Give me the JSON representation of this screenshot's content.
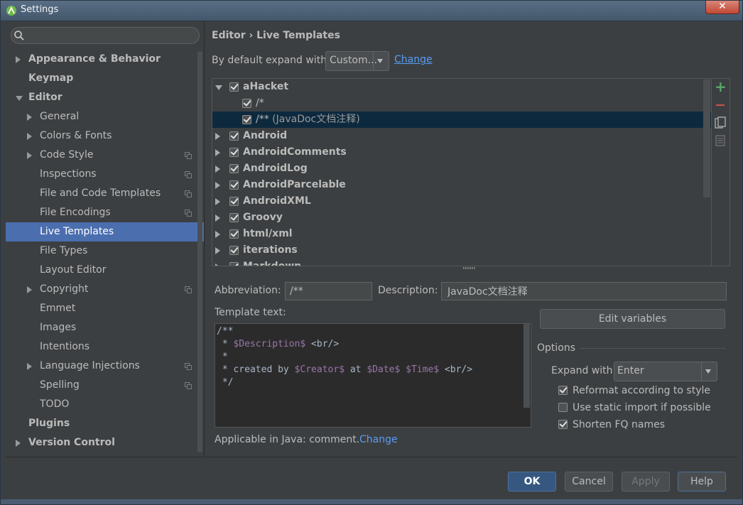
{
  "window": {
    "title": "Settings",
    "close_label": "✕"
  },
  "search": {
    "placeholder": "",
    "value": ""
  },
  "sidebar": {
    "items": [
      {
        "label": "Appearance & Behavior",
        "level": 0,
        "bold": true,
        "arrow": "right"
      },
      {
        "label": "Keymap",
        "level": 0,
        "bold": true,
        "arrow": "none"
      },
      {
        "label": "Editor",
        "level": 0,
        "bold": true,
        "arrow": "down"
      },
      {
        "label": "General",
        "level": 1,
        "bold": false,
        "arrow": "right"
      },
      {
        "label": "Colors & Fonts",
        "level": 1,
        "bold": false,
        "arrow": "right"
      },
      {
        "label": "Code Style",
        "level": 1,
        "bold": false,
        "arrow": "right",
        "project": true
      },
      {
        "label": "Inspections",
        "level": 1,
        "bold": false,
        "arrow": "none",
        "project": true
      },
      {
        "label": "File and Code Templates",
        "level": 1,
        "bold": false,
        "arrow": "none",
        "project": true
      },
      {
        "label": "File Encodings",
        "level": 1,
        "bold": false,
        "arrow": "none",
        "project": true
      },
      {
        "label": "Live Templates",
        "level": 1,
        "bold": false,
        "arrow": "none",
        "selected": true
      },
      {
        "label": "File Types",
        "level": 1,
        "bold": false,
        "arrow": "none"
      },
      {
        "label": "Layout Editor",
        "level": 1,
        "bold": false,
        "arrow": "none"
      },
      {
        "label": "Copyright",
        "level": 1,
        "bold": false,
        "arrow": "right",
        "project": true
      },
      {
        "label": "Emmet",
        "level": 1,
        "bold": false,
        "arrow": "none"
      },
      {
        "label": "Images",
        "level": 1,
        "bold": false,
        "arrow": "none"
      },
      {
        "label": "Intentions",
        "level": 1,
        "bold": false,
        "arrow": "none"
      },
      {
        "label": "Language Injections",
        "level": 1,
        "bold": false,
        "arrow": "right",
        "project": true
      },
      {
        "label": "Spelling",
        "level": 1,
        "bold": false,
        "arrow": "none",
        "project": true
      },
      {
        "label": "TODO",
        "level": 1,
        "bold": false,
        "arrow": "none"
      },
      {
        "label": "Plugins",
        "level": 0,
        "bold": true,
        "arrow": "none"
      },
      {
        "label": "Version Control",
        "level": 0,
        "bold": true,
        "arrow": "right"
      }
    ]
  },
  "header": {
    "breadcrumb_parent": "Editor",
    "breadcrumb_sep": "›",
    "breadcrumb_current": "Live Templates",
    "expand_label": "By default expand with",
    "expand_value": "Custom...",
    "change_link": "Change"
  },
  "tree": {
    "rows": [
      {
        "label": "aHacket",
        "bold": true,
        "arrow": "down",
        "checked": true,
        "indent": 0
      },
      {
        "label": "/*",
        "bold": false,
        "arrow": "none",
        "checked": true,
        "indent": 1
      },
      {
        "label": "/**",
        "desc": "(JavaDoc文档注释)",
        "bold": false,
        "arrow": "none",
        "checked": true,
        "indent": 1,
        "selected": true
      },
      {
        "label": "Android",
        "bold": true,
        "arrow": "right",
        "checked": true,
        "indent": 0
      },
      {
        "label": "AndroidComments",
        "bold": true,
        "arrow": "right",
        "checked": true,
        "indent": 0
      },
      {
        "label": "AndroidLog",
        "bold": true,
        "arrow": "right",
        "checked": true,
        "indent": 0
      },
      {
        "label": "AndroidParcelable",
        "bold": true,
        "arrow": "right",
        "checked": true,
        "indent": 0
      },
      {
        "label": "AndroidXML",
        "bold": true,
        "arrow": "right",
        "checked": true,
        "indent": 0
      },
      {
        "label": "Groovy",
        "bold": true,
        "arrow": "right",
        "checked": true,
        "indent": 0
      },
      {
        "label": "html/xml",
        "bold": true,
        "arrow": "right",
        "checked": true,
        "indent": 0
      },
      {
        "label": "iterations",
        "bold": true,
        "arrow": "right",
        "checked": true,
        "indent": 0
      },
      {
        "label": "Markdown",
        "bold": true,
        "arrow": "right",
        "checked": true,
        "indent": 0
      }
    ]
  },
  "form": {
    "abbreviation_label": "Abbreviation:",
    "abbreviation_value": "/**",
    "description_label": "Description:",
    "description_value": "JavaDoc文档注释",
    "template_text_label": "Template text:",
    "template_lines": [
      [
        {
          "t": "/**",
          "v": false
        }
      ],
      [
        {
          "t": " * ",
          "v": false
        },
        {
          "t": "$Description$",
          "v": true
        },
        {
          "t": " <br/>",
          "v": false
        }
      ],
      [
        {
          "t": " *",
          "v": false
        }
      ],
      [
        {
          "t": " * created by ",
          "v": false
        },
        {
          "t": "$Creator$",
          "v": true
        },
        {
          "t": " at ",
          "v": false
        },
        {
          "t": "$Date$",
          "v": true
        },
        {
          "t": " ",
          "v": false
        },
        {
          "t": "$Time$",
          "v": true
        },
        {
          "t": " <br/>",
          "v": false
        }
      ],
      [
        {
          "t": " */",
          "v": false
        }
      ]
    ],
    "edit_variables": "Edit variables",
    "options_label": "Options",
    "expand_with_label": "Expand with",
    "expand_with_value": "Enter",
    "options": [
      {
        "label": "Reformat according to style",
        "checked": true
      },
      {
        "label": "Use static import if possible",
        "checked": false
      },
      {
        "label": "Shorten FQ names",
        "checked": true
      }
    ],
    "applicable_text": "Applicable in Java: comment.",
    "applicable_change": "Change"
  },
  "buttons": {
    "ok": "OK",
    "cancel": "Cancel",
    "apply": "Apply",
    "help": "Help"
  },
  "colors": {
    "background": "#3c3f41",
    "selection": "#4b6eaf",
    "tree_selection": "#0d293e",
    "link": "#589df6",
    "template_var": "#9876aa"
  }
}
